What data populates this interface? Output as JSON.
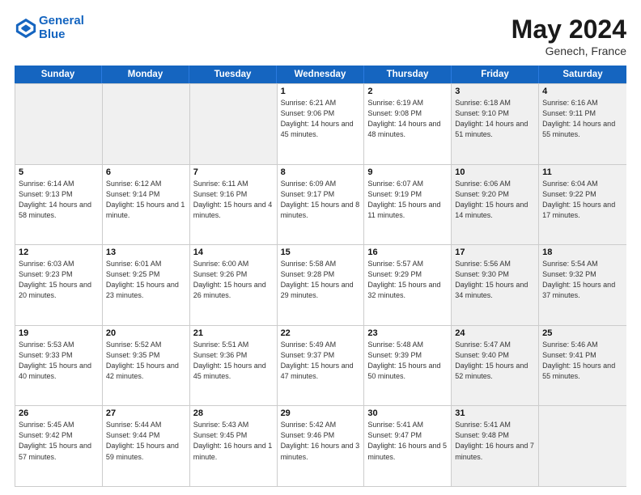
{
  "header": {
    "logo_line1": "General",
    "logo_line2": "Blue",
    "month": "May 2024",
    "location": "Genech, France"
  },
  "weekdays": [
    "Sunday",
    "Monday",
    "Tuesday",
    "Wednesday",
    "Thursday",
    "Friday",
    "Saturday"
  ],
  "weeks": [
    [
      {
        "day": "",
        "sunrise": "",
        "sunset": "",
        "daylight": "",
        "shaded": true
      },
      {
        "day": "",
        "sunrise": "",
        "sunset": "",
        "daylight": "",
        "shaded": true
      },
      {
        "day": "",
        "sunrise": "",
        "sunset": "",
        "daylight": "",
        "shaded": true
      },
      {
        "day": "1",
        "sunrise": "Sunrise: 6:21 AM",
        "sunset": "Sunset: 9:06 PM",
        "daylight": "Daylight: 14 hours and 45 minutes.",
        "shaded": false
      },
      {
        "day": "2",
        "sunrise": "Sunrise: 6:19 AM",
        "sunset": "Sunset: 9:08 PM",
        "daylight": "Daylight: 14 hours and 48 minutes.",
        "shaded": false
      },
      {
        "day": "3",
        "sunrise": "Sunrise: 6:18 AM",
        "sunset": "Sunset: 9:10 PM",
        "daylight": "Daylight: 14 hours and 51 minutes.",
        "shaded": true
      },
      {
        "day": "4",
        "sunrise": "Sunrise: 6:16 AM",
        "sunset": "Sunset: 9:11 PM",
        "daylight": "Daylight: 14 hours and 55 minutes.",
        "shaded": true
      }
    ],
    [
      {
        "day": "5",
        "sunrise": "Sunrise: 6:14 AM",
        "sunset": "Sunset: 9:13 PM",
        "daylight": "Daylight: 14 hours and 58 minutes.",
        "shaded": false
      },
      {
        "day": "6",
        "sunrise": "Sunrise: 6:12 AM",
        "sunset": "Sunset: 9:14 PM",
        "daylight": "Daylight: 15 hours and 1 minute.",
        "shaded": false
      },
      {
        "day": "7",
        "sunrise": "Sunrise: 6:11 AM",
        "sunset": "Sunset: 9:16 PM",
        "daylight": "Daylight: 15 hours and 4 minutes.",
        "shaded": false
      },
      {
        "day": "8",
        "sunrise": "Sunrise: 6:09 AM",
        "sunset": "Sunset: 9:17 PM",
        "daylight": "Daylight: 15 hours and 8 minutes.",
        "shaded": false
      },
      {
        "day": "9",
        "sunrise": "Sunrise: 6:07 AM",
        "sunset": "Sunset: 9:19 PM",
        "daylight": "Daylight: 15 hours and 11 minutes.",
        "shaded": false
      },
      {
        "day": "10",
        "sunrise": "Sunrise: 6:06 AM",
        "sunset": "Sunset: 9:20 PM",
        "daylight": "Daylight: 15 hours and 14 minutes.",
        "shaded": true
      },
      {
        "day": "11",
        "sunrise": "Sunrise: 6:04 AM",
        "sunset": "Sunset: 9:22 PM",
        "daylight": "Daylight: 15 hours and 17 minutes.",
        "shaded": true
      }
    ],
    [
      {
        "day": "12",
        "sunrise": "Sunrise: 6:03 AM",
        "sunset": "Sunset: 9:23 PM",
        "daylight": "Daylight: 15 hours and 20 minutes.",
        "shaded": false
      },
      {
        "day": "13",
        "sunrise": "Sunrise: 6:01 AM",
        "sunset": "Sunset: 9:25 PM",
        "daylight": "Daylight: 15 hours and 23 minutes.",
        "shaded": false
      },
      {
        "day": "14",
        "sunrise": "Sunrise: 6:00 AM",
        "sunset": "Sunset: 9:26 PM",
        "daylight": "Daylight: 15 hours and 26 minutes.",
        "shaded": false
      },
      {
        "day": "15",
        "sunrise": "Sunrise: 5:58 AM",
        "sunset": "Sunset: 9:28 PM",
        "daylight": "Daylight: 15 hours and 29 minutes.",
        "shaded": false
      },
      {
        "day": "16",
        "sunrise": "Sunrise: 5:57 AM",
        "sunset": "Sunset: 9:29 PM",
        "daylight": "Daylight: 15 hours and 32 minutes.",
        "shaded": false
      },
      {
        "day": "17",
        "sunrise": "Sunrise: 5:56 AM",
        "sunset": "Sunset: 9:30 PM",
        "daylight": "Daylight: 15 hours and 34 minutes.",
        "shaded": true
      },
      {
        "day": "18",
        "sunrise": "Sunrise: 5:54 AM",
        "sunset": "Sunset: 9:32 PM",
        "daylight": "Daylight: 15 hours and 37 minutes.",
        "shaded": true
      }
    ],
    [
      {
        "day": "19",
        "sunrise": "Sunrise: 5:53 AM",
        "sunset": "Sunset: 9:33 PM",
        "daylight": "Daylight: 15 hours and 40 minutes.",
        "shaded": false
      },
      {
        "day": "20",
        "sunrise": "Sunrise: 5:52 AM",
        "sunset": "Sunset: 9:35 PM",
        "daylight": "Daylight: 15 hours and 42 minutes.",
        "shaded": false
      },
      {
        "day": "21",
        "sunrise": "Sunrise: 5:51 AM",
        "sunset": "Sunset: 9:36 PM",
        "daylight": "Daylight: 15 hours and 45 minutes.",
        "shaded": false
      },
      {
        "day": "22",
        "sunrise": "Sunrise: 5:49 AM",
        "sunset": "Sunset: 9:37 PM",
        "daylight": "Daylight: 15 hours and 47 minutes.",
        "shaded": false
      },
      {
        "day": "23",
        "sunrise": "Sunrise: 5:48 AM",
        "sunset": "Sunset: 9:39 PM",
        "daylight": "Daylight: 15 hours and 50 minutes.",
        "shaded": false
      },
      {
        "day": "24",
        "sunrise": "Sunrise: 5:47 AM",
        "sunset": "Sunset: 9:40 PM",
        "daylight": "Daylight: 15 hours and 52 minutes.",
        "shaded": true
      },
      {
        "day": "25",
        "sunrise": "Sunrise: 5:46 AM",
        "sunset": "Sunset: 9:41 PM",
        "daylight": "Daylight: 15 hours and 55 minutes.",
        "shaded": true
      }
    ],
    [
      {
        "day": "26",
        "sunrise": "Sunrise: 5:45 AM",
        "sunset": "Sunset: 9:42 PM",
        "daylight": "Daylight: 15 hours and 57 minutes.",
        "shaded": false
      },
      {
        "day": "27",
        "sunrise": "Sunrise: 5:44 AM",
        "sunset": "Sunset: 9:44 PM",
        "daylight": "Daylight: 15 hours and 59 minutes.",
        "shaded": false
      },
      {
        "day": "28",
        "sunrise": "Sunrise: 5:43 AM",
        "sunset": "Sunset: 9:45 PM",
        "daylight": "Daylight: 16 hours and 1 minute.",
        "shaded": false
      },
      {
        "day": "29",
        "sunrise": "Sunrise: 5:42 AM",
        "sunset": "Sunset: 9:46 PM",
        "daylight": "Daylight: 16 hours and 3 minutes.",
        "shaded": false
      },
      {
        "day": "30",
        "sunrise": "Sunrise: 5:41 AM",
        "sunset": "Sunset: 9:47 PM",
        "daylight": "Daylight: 16 hours and 5 minutes.",
        "shaded": false
      },
      {
        "day": "31",
        "sunrise": "Sunrise: 5:41 AM",
        "sunset": "Sunset: 9:48 PM",
        "daylight": "Daylight: 16 hours and 7 minutes.",
        "shaded": true
      },
      {
        "day": "",
        "sunrise": "",
        "sunset": "",
        "daylight": "",
        "shaded": true
      }
    ]
  ]
}
